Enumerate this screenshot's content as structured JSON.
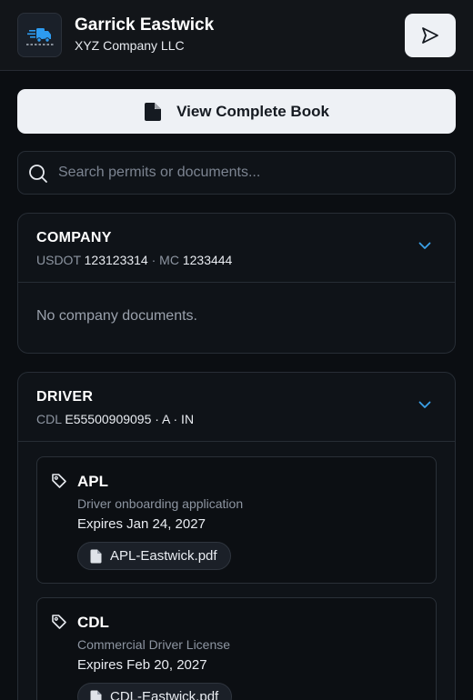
{
  "header": {
    "user_name": "Garrick Eastwick",
    "company": "XYZ Company LLC",
    "logo_icon": "truck-icon",
    "send_icon": "send-icon"
  },
  "book_button": {
    "label": "View Complete Book",
    "icon": "document-icon"
  },
  "search": {
    "placeholder": "Search permits or documents...",
    "value": "",
    "icon": "search-icon"
  },
  "company_section": {
    "title": "COMPANY",
    "usdot_label": "USDOT",
    "usdot_value": "123123314",
    "separator": "·",
    "mc_label": "MC",
    "mc_value": "1233444",
    "empty_text": "No company documents."
  },
  "driver_section": {
    "title": "DRIVER",
    "cdl_label": "CDL",
    "cdl_value": "E55500909095 · A · IN",
    "documents": [
      {
        "title": "APL",
        "description": "Driver onboarding application",
        "expires": "Expires Jan 24, 2027",
        "file": "APL-Eastwick.pdf"
      },
      {
        "title": "CDL",
        "description": "Commercial Driver License",
        "expires": "Expires Feb 20, 2027",
        "file": "CDL-Eastwick.pdf"
      }
    ]
  },
  "colors": {
    "background": "#0b0e12",
    "card": "#0f1318",
    "accent": "#3aa0e8",
    "logo_blue": "#2d9bf0",
    "button_bg": "#eef1f5"
  }
}
